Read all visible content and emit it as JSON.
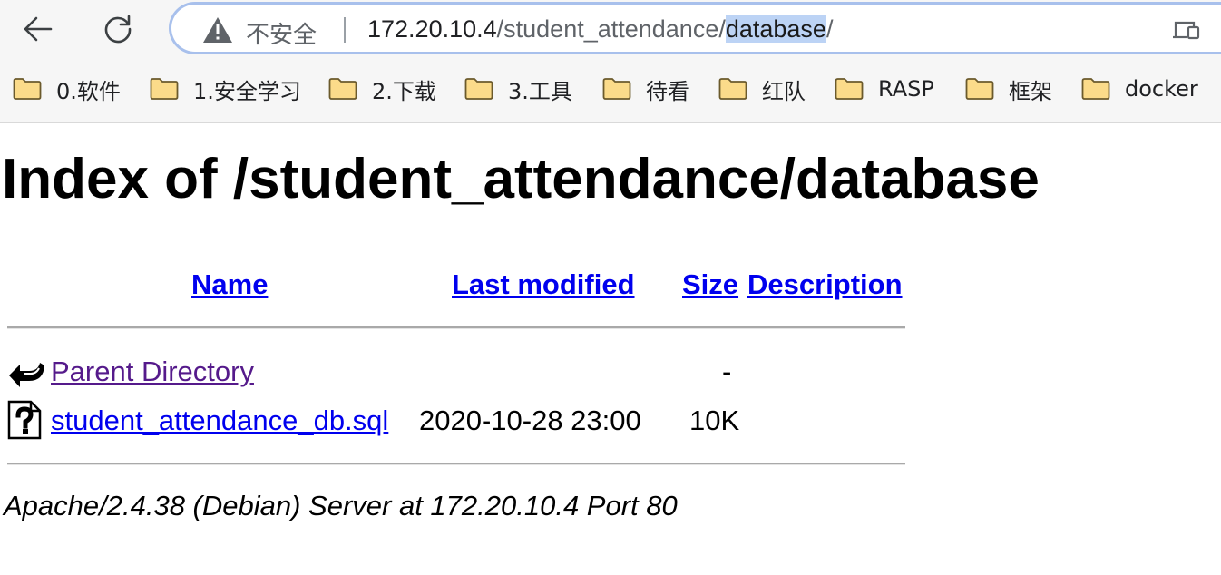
{
  "browser": {
    "security_label": "不安全",
    "url": {
      "host": "172.20.10.4",
      "path": "/student_attendance/",
      "selected": "database",
      "trailing": "/"
    },
    "bookmarks": [
      {
        "label": "0.软件"
      },
      {
        "label": "1.安全学习"
      },
      {
        "label": "2.下载"
      },
      {
        "label": "3.工具"
      },
      {
        "label": "待看"
      },
      {
        "label": "红队"
      },
      {
        "label": "RASP"
      },
      {
        "label": "框架"
      },
      {
        "label": "docker"
      }
    ]
  },
  "page": {
    "title": "Index of /student_attendance/database",
    "columns": {
      "name": "Name",
      "last_modified": "Last modified",
      "size": "Size",
      "description": "Description"
    },
    "rows": [
      {
        "icon": "back-icon",
        "name": "Parent Directory",
        "last_modified": "",
        "size": "-",
        "description": ""
      },
      {
        "icon": "unknown-file-icon",
        "name": "student_attendance_db.sql",
        "last_modified": "2020-10-28 23:00",
        "size": "10K",
        "description": ""
      }
    ],
    "footer": "Apache/2.4.38 (Debian) Server at 172.20.10.4 Port 80"
  },
  "colors": {
    "link": "#0000ee",
    "visited_link": "#551a8b",
    "address_focus_border": "#a8c0ec",
    "selection": "#bcd3f5"
  }
}
